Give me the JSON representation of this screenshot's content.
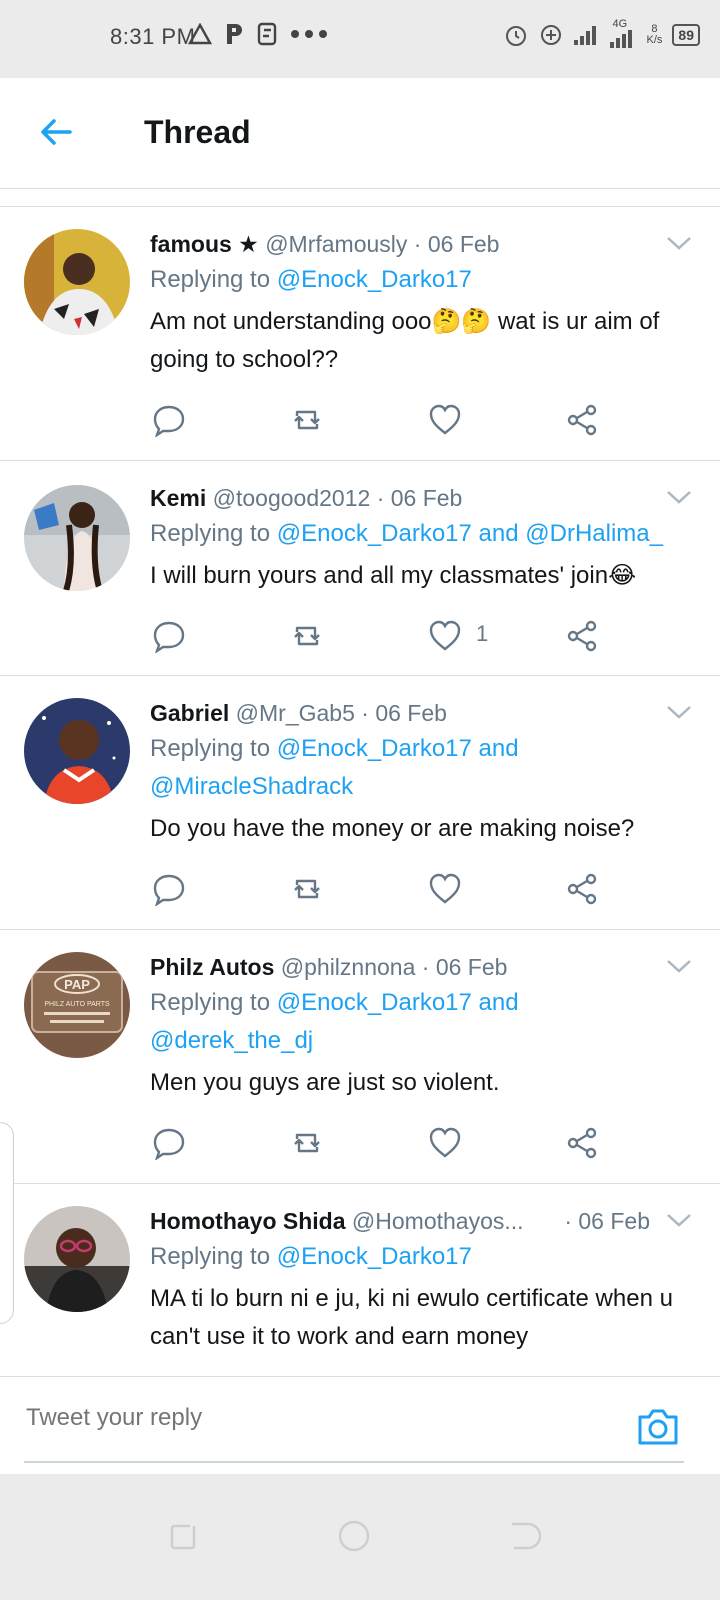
{
  "status_bar": {
    "time": "8:31 PM",
    "network": "4G",
    "speed_value": "8",
    "speed_unit": "K/s",
    "battery": "89"
  },
  "header": {
    "title": "Thread"
  },
  "tweets": [
    {
      "name": "famous ★",
      "handle": "@Mrfamously",
      "date": "· 06 Feb",
      "replying_prefix": "Replying to",
      "mentions": "@Enock_Darko17",
      "mentions_2": "",
      "text": "Am not understanding ooo🤔🤔 wat is ur aim of going to school??",
      "like_count": ""
    },
    {
      "name": "Kemi",
      "handle": "@toogood2012",
      "date": "· 06 Feb",
      "replying_prefix": "Replying to",
      "mentions": "@Enock_Darko17 and @DrHalima_",
      "mentions_2": "",
      "text": "I will burn yours and all my classmates' join😂",
      "like_count": "1"
    },
    {
      "name": "Gabriel",
      "handle": "@Mr_Gab5",
      "date": "· 06 Feb",
      "replying_prefix": "Replying to",
      "mentions": "@Enock_Darko17 and",
      "mentions_2": "@MiracleShadrack",
      "text": "Do you have the money or are making noise?",
      "like_count": ""
    },
    {
      "name": "Philz Autos",
      "handle": "@philznnona",
      "date": "· 06 Feb",
      "replying_prefix": "Replying to",
      "mentions": "@Enock_Darko17 and",
      "mentions_2": "@derek_the_dj",
      "text": "Men you guys are just so violent.",
      "like_count": ""
    },
    {
      "name": "Homothayo Shida",
      "handle": "@Homothayos...",
      "date": "· 06 Feb",
      "replying_prefix": "Replying to",
      "mentions": "@Enock_Darko17",
      "mentions_2": "",
      "text": "MA ti lo burn ni e ju, ki ni ewulo certificate when u can't use it to work and earn money",
      "like_count": ""
    }
  ],
  "avatar_text": {
    "philz_brand": "PAP",
    "philz_sub": "PHILZ AUTO PARTS"
  },
  "reply_bar": {
    "placeholder": "Tweet your reply"
  },
  "colors": {
    "accent": "#1da1f2",
    "secondary_text": "#657786",
    "divider": "#dbe0e4"
  },
  "icons": [
    "back-arrow-icon",
    "reply-icon",
    "retweet-icon",
    "like-icon",
    "share-icon",
    "chevron-down-icon",
    "camera-icon",
    "alarm-icon",
    "data-saver-icon",
    "signal-icon",
    "battery-icon",
    "nav-recents-icon",
    "nav-home-icon",
    "nav-back-icon"
  ]
}
